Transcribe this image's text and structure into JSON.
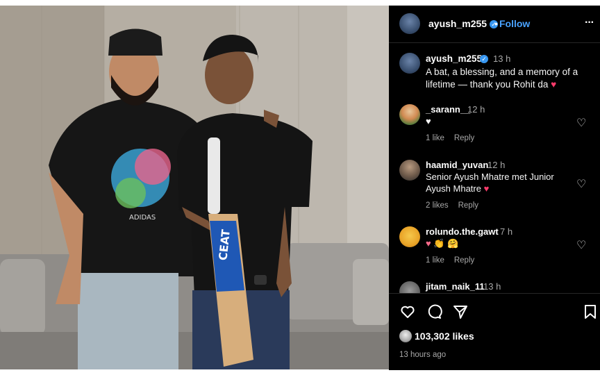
{
  "post": {
    "username": "ayush_m255",
    "verified_mark": "✓",
    "follow_label": "Follow",
    "separator": "•",
    "more_label": "···"
  },
  "caption": {
    "username": "ayush_m255",
    "time": "13 h",
    "text": "A bat, a blessing, and a memory of a lifetime — thank you Rohit da",
    "emoji": "♥"
  },
  "comments": [
    {
      "username": "_sarann__",
      "time": "12 h",
      "text": "♥",
      "likes": "1 like",
      "reply": "Reply"
    },
    {
      "username": "haamid_yuvan",
      "time": "12 h",
      "text": "Senior Ayush Mhatre met Junior Ayush Mhatre",
      "emoji": "♥",
      "likes": "2 likes",
      "reply": "Reply"
    },
    {
      "username": "rolundo.the.gawt",
      "time": "7 h",
      "text": "♥ 👏 🤗",
      "likes": "1 like",
      "reply": "Reply"
    },
    {
      "username": "jitam_naik_11",
      "time": "13 h"
    }
  ],
  "footer": {
    "likes": "103,302 likes",
    "ago": "13 hours ago"
  },
  "photo": {
    "bat_brand": "CEAT",
    "shirt_text": "ADIDAS"
  },
  "colors": {
    "background": "#000000",
    "link": "#4aa3ff",
    "verified": "#3897f0",
    "heart": "#ff3b6b",
    "muted": "#a8a8a8"
  },
  "icons": [
    "verified-icon",
    "more-options-icon",
    "like-heart-icon",
    "comment-icon",
    "share-icon",
    "save-icon"
  ]
}
